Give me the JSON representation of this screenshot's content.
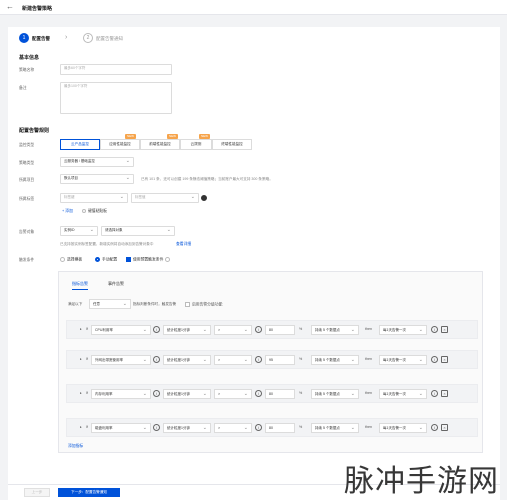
{
  "header": {
    "back_icon": "arrow-left-icon",
    "title": "新建告警策略"
  },
  "steps": [
    {
      "num": "1",
      "label": "配置告警"
    },
    {
      "num": "2",
      "label": "配置告警通知"
    }
  ],
  "basic": {
    "title": "基本信息",
    "name_label": "策略名称",
    "name_placeholder": "最多60个字符",
    "remark_label": "备注",
    "remark_placeholder": "最多100个字符"
  },
  "rules": {
    "title": "配置告警规则",
    "monitor_type_label": "监控类型",
    "monitor_types": [
      {
        "label": "云产品监控",
        "tag": ""
      },
      {
        "label": "应用性能监控",
        "tag": "NEW"
      },
      {
        "label": "前端性能监控",
        "tag": "NEW"
      },
      {
        "label": "云拨测",
        "tag": "NEW"
      },
      {
        "label": "终端性能监控",
        "tag": ""
      }
    ],
    "policy_type_label": "策略类型",
    "policy_type_value": "云服务器 / 基础监控",
    "project_label": "所属项目",
    "project_value": "默认项目",
    "project_hint": "已有 101 条，还可以创建 199 条静态阈值策略；当前账户最大可支持 300 条策略。",
    "tag_label": "所属标签",
    "tag_key_placeholder": "标签键",
    "tag_value_placeholder": "标签值",
    "add_link": "+ 添加",
    "tag_key_value_link": "键值粘贴板",
    "object_label": "告警对象",
    "object_type": "实例ID",
    "object_value": "请选择对象",
    "object_hint": "已支持按实例标签配置，新增实例将自动添加到告警对象中",
    "object_hint_link": "查看详细",
    "trigger_label": "触发条件",
    "trigger_template": "选择模板",
    "trigger_manual": "手动配置",
    "trigger_apply": "使用预置触发条件"
  },
  "rule_box": {
    "tabs": [
      "指标告警",
      "事件告警"
    ],
    "condition_prefix": "满足以下",
    "condition_value": "任意",
    "condition_suffix": "指标判断条件时，触发告警",
    "alarm_level_toggle": "启用告警分级功能",
    "rows": [
      {
        "metric": "CPU利用率",
        "period": "统计粒度1分钟",
        "op": ">",
        "value": "80",
        "unit": "%",
        "duration": "持续 5 个数据点",
        "then": "then",
        "repeat": "每1天告警一次"
      },
      {
        "metric": "外网出带宽使用率",
        "period": "统计粒度1分钟",
        "op": ">",
        "value": "95",
        "unit": "%",
        "duration": "持续 5 个数据点",
        "then": "then",
        "repeat": "每1天告警一次"
      },
      {
        "metric": "内存利用率",
        "period": "统计粒度1分钟",
        "op": ">",
        "value": "80",
        "unit": "%",
        "duration": "持续 5 个数据点",
        "then": "then",
        "repeat": "每1天告警一次"
      },
      {
        "metric": "磁盘利用率",
        "period": "统计粒度1分钟",
        "op": ">",
        "value": "80",
        "unit": "%",
        "duration": "持续 5 个数据点",
        "then": "then",
        "repeat": "每1天告警一次"
      }
    ],
    "add_metric": "添加指标"
  },
  "footer": {
    "prev": "上一步",
    "next": "下一步：配置告警通知"
  },
  "watermark": "脉冲手游网",
  "colors": {
    "primary": "#0052d9",
    "tag_new": "#f6a44b"
  }
}
